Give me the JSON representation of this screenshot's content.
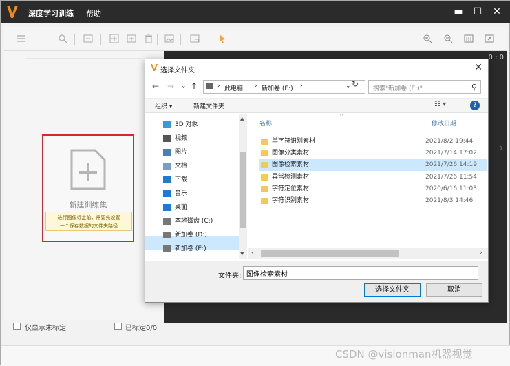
{
  "app": {
    "title": "深度学习训练",
    "menu_help": "帮助"
  },
  "left_panel": {
    "new_set_label": "新建训练集",
    "tip_line1": "进行图像标定前，需要先设置",
    "tip_line2": "一个保存数据的文件夹路径"
  },
  "preview": {
    "zoom": "0 : 0"
  },
  "bottom": {
    "only_unlabeled": "仅显示未标定",
    "labeled_count": "已标定0/0"
  },
  "watermark": "CSDN @visionman机器视觉",
  "dialog": {
    "title": "选择文件夹",
    "breadcrumb": [
      "此电脑",
      "新加卷 (E:)"
    ],
    "search_placeholder": "搜索\"新加卷 (E:)\"",
    "organize": "组织 ▾",
    "new_folder": "新建文件夹",
    "nav_items": [
      {
        "label": "3D 对象",
        "icon": "3d-objects-icon",
        "color": "#3a9ad9"
      },
      {
        "label": "视频",
        "icon": "video-icon",
        "color": "#555555"
      },
      {
        "label": "图片",
        "icon": "pictures-icon",
        "color": "#4a7fb5"
      },
      {
        "label": "文档",
        "icon": "documents-icon",
        "color": "#7a9cc6"
      },
      {
        "label": "下载",
        "icon": "downloads-icon",
        "color": "#1f7ad6"
      },
      {
        "label": "音乐",
        "icon": "music-icon",
        "color": "#1f7ad6"
      },
      {
        "label": "桌面",
        "icon": "desktop-icon",
        "color": "#1f7ad6"
      },
      {
        "label": "本地磁盘 (C:)",
        "icon": "local-disk-icon",
        "color": "#777777"
      },
      {
        "label": "新加卷 (D:)",
        "icon": "drive-icon",
        "color": "#777777"
      },
      {
        "label": "新加卷 (E:)",
        "icon": "drive-icon",
        "color": "#777777"
      }
    ],
    "columns": {
      "name": "名称",
      "modified": "修改日期"
    },
    "files": [
      {
        "name": "单字符识别素材",
        "date": "2021/8/2 19:44"
      },
      {
        "name": "图像分类素材",
        "date": "2021/7/14 17:02"
      },
      {
        "name": "图像检索素材",
        "date": "2021/7/26 14:19"
      },
      {
        "name": "异常检测素材",
        "date": "2021/7/26 11:54"
      },
      {
        "name": "字符定位素材",
        "date": "2020/6/16 11:03"
      },
      {
        "name": "字符识别素材",
        "date": "2021/8/3 14:46"
      }
    ],
    "selected_file_index": 2,
    "folder_label": "文件夹:",
    "folder_value": "图像检索素材",
    "select_button": "选择文件夹",
    "cancel_button": "取消"
  }
}
